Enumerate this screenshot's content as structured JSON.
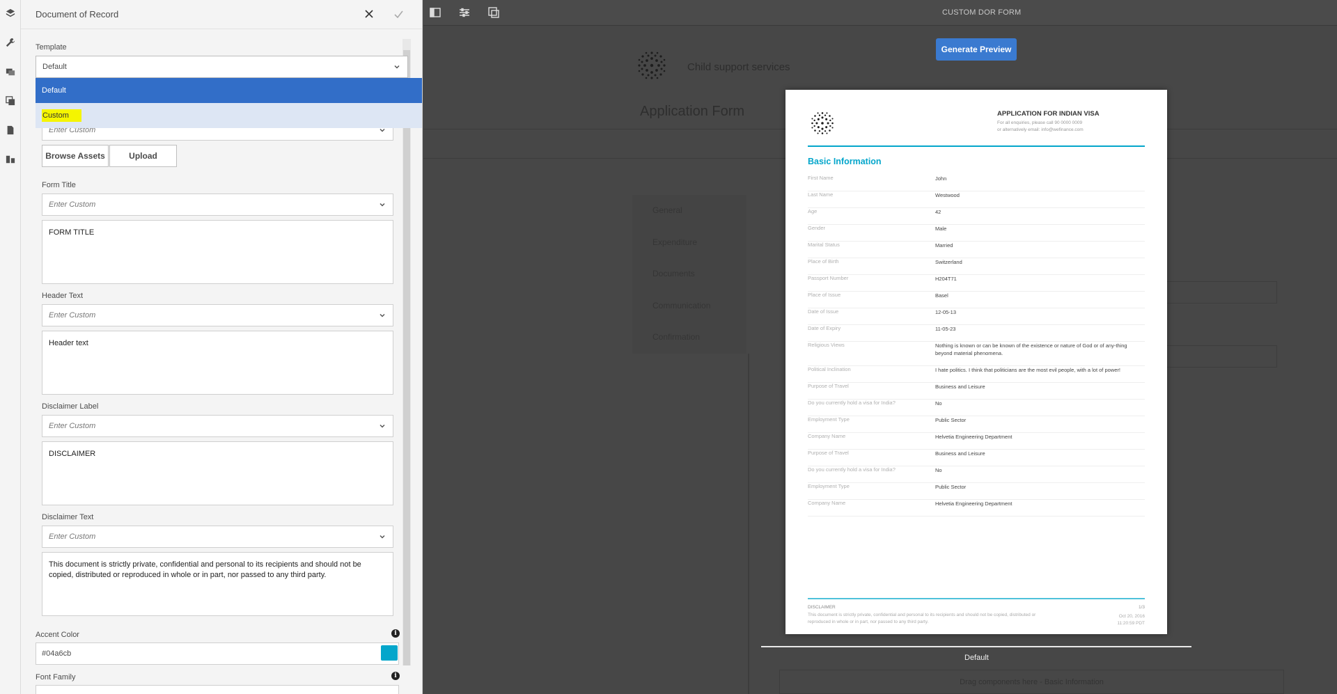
{
  "panel": {
    "title": "Document of Record",
    "template": {
      "label": "Template",
      "value": "Default",
      "options": [
        "Default",
        "Custom"
      ]
    },
    "logo": {
      "placeholder": "Enter Custom",
      "browse_label": "Browse Assets",
      "upload_label": "Upload"
    },
    "form_title": {
      "label": "Form Title",
      "placeholder": "Enter Custom",
      "text": "FORM TITLE"
    },
    "header_text": {
      "label": "Header Text",
      "placeholder": "Enter Custom",
      "text": "Header text"
    },
    "disclaimer_label": {
      "label": "Disclaimer Label",
      "placeholder": "Enter Custom",
      "text": "DISCLAIMER"
    },
    "disclaimer_text": {
      "label": "Disclaimer Text",
      "placeholder": "Enter Custom",
      "text": "This document is strictly private, confidential and personal to its recipients and should not be copied, distributed or reproduced in whole or in part, nor passed to any third party."
    },
    "accent_color": {
      "label": "Accent Color",
      "value": "#04a6cb"
    },
    "font_family": {
      "label": "Font Family"
    }
  },
  "toolbar": {
    "title": "CUSTOM DOR FORM"
  },
  "preview_button": "Generate Preview",
  "background_form": {
    "brand": "Child support services",
    "title": "Application Form",
    "nav": [
      "General",
      "Expenditure",
      "Documents",
      "Communication",
      "Confirmation"
    ],
    "footer_label": "Default",
    "drag_hint": "Drag components here - Basic Information"
  },
  "document": {
    "heading": "APPLICATION FOR INDIAN VISA",
    "subheading_1": "For all enquiries, please call 90 0000 0009",
    "subheading_2": "or alternatively email: info@wefinance.com",
    "section": "Basic Information",
    "rows": [
      {
        "k": "First Name",
        "v": "John"
      },
      {
        "k": "Last Name",
        "v": "Westwood"
      },
      {
        "k": "Age",
        "v": "42"
      },
      {
        "k": "Gender",
        "v": "Male"
      },
      {
        "k": "Marital Status",
        "v": "Married"
      },
      {
        "k": "Place of Birth",
        "v": "Switzerland"
      },
      {
        "k": "Passport Number",
        "v": "H204T71"
      },
      {
        "k": "Place of Issue",
        "v": "Basel"
      },
      {
        "k": "Date of Issue",
        "v": "12-05-13"
      },
      {
        "k": "Date of Expiry",
        "v": "11-05-23"
      },
      {
        "k": "Religious Views",
        "v": "Nothing is known or can be known of the existence or nature of God or of any-thing beyond material phenomena."
      },
      {
        "k": "Political Inclination",
        "v": "I hate politics. I think that politicians are the most evil people, with a lot of power!"
      },
      {
        "k": "Purpose of Travel",
        "v": "Business and Leisure"
      },
      {
        "k": "Do you currently hold a visa for India?",
        "v": "No"
      },
      {
        "k": "Employment Type",
        "v": "Public Sector"
      },
      {
        "k": "Company Name",
        "v": "Helvetia Engineering Department"
      },
      {
        "k": "Purpose of Travel",
        "v": "Business and Leisure"
      },
      {
        "k": "Do you currently hold a visa for India?",
        "v": "No"
      },
      {
        "k": "Employment Type",
        "v": "Public Sector"
      },
      {
        "k": "Company Name",
        "v": "Helvetia Engineering Department"
      }
    ],
    "disclaimer_label": "DISCLAIMER",
    "disclaimer_text": "This document is strictly private, confidential and personal to its recipients and should not be copied, distributed or reproduced in whole or in part, nor passed to any third party.",
    "page": "1/3",
    "date": "Oct 20, 2016",
    "time": "11:20:59 PDT"
  }
}
